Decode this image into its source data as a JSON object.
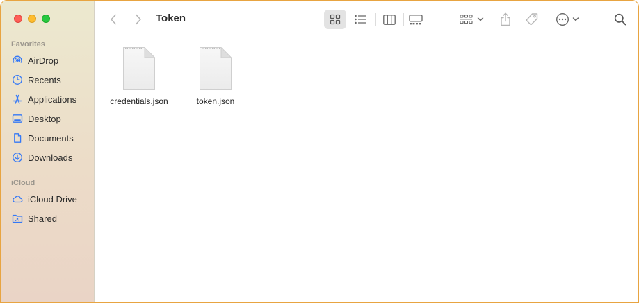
{
  "window": {
    "title": "Token"
  },
  "sidebar": {
    "sections": [
      {
        "title": "Favorites",
        "items": [
          {
            "label": "AirDrop",
            "icon": "airdrop-icon"
          },
          {
            "label": "Recents",
            "icon": "clock-icon"
          },
          {
            "label": "Applications",
            "icon": "applications-icon"
          },
          {
            "label": "Desktop",
            "icon": "desktop-icon"
          },
          {
            "label": "Documents",
            "icon": "document-icon"
          },
          {
            "label": "Downloads",
            "icon": "download-icon"
          }
        ]
      },
      {
        "title": "iCloud",
        "items": [
          {
            "label": "iCloud Drive",
            "icon": "cloud-icon"
          },
          {
            "label": "Shared",
            "icon": "shared-folder-icon"
          }
        ]
      }
    ]
  },
  "toolbar": {
    "view_mode": "icons",
    "buttons": [
      "back",
      "forward",
      "icon-view",
      "list-view",
      "column-view",
      "gallery-view",
      "group",
      "share",
      "tag",
      "more-actions",
      "search"
    ]
  },
  "files": [
    {
      "name": "credentials.json",
      "icon": "json-document-icon"
    },
    {
      "name": "token.json",
      "icon": "json-document-icon"
    }
  ],
  "colors": {
    "sidebar_icon": "#3478f6",
    "window_border": "#e8a441",
    "close": "#fe5f57",
    "minimize": "#febc2e",
    "zoom": "#28c840"
  }
}
